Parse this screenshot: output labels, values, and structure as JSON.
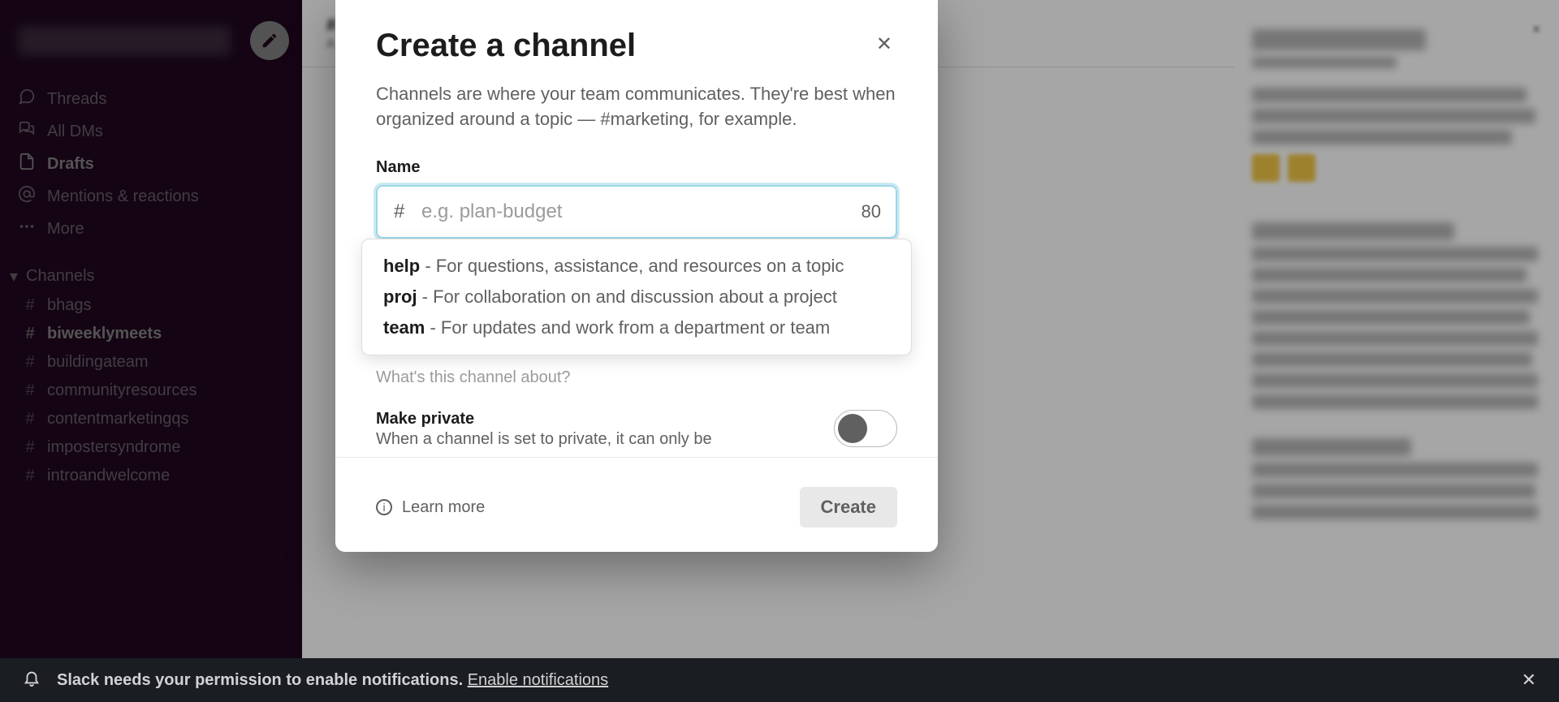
{
  "sidebar": {
    "nav": [
      {
        "label": "Threads",
        "icon": "threads-icon"
      },
      {
        "label": "All DMs",
        "icon": "dms-icon"
      },
      {
        "label": "Drafts",
        "icon": "drafts-icon",
        "bold": true
      },
      {
        "label": "Mentions & reactions",
        "icon": "mentions-icon"
      },
      {
        "label": "More",
        "icon": "more-icon"
      }
    ],
    "channels_header": "Channels",
    "channels": [
      {
        "name": "bhags"
      },
      {
        "name": "biweeklymeets",
        "bold": true
      },
      {
        "name": "buildingateam"
      },
      {
        "name": "communityresources"
      },
      {
        "name": "contentmarketingqs"
      },
      {
        "name": "impostersyndrome"
      },
      {
        "name": "introandwelcome"
      }
    ]
  },
  "main_header": {
    "line1_prefix": "#",
    "line2_prefix": "A"
  },
  "modal": {
    "title": "Create a channel",
    "description": "Channels are where your team communicates. They're best when organized around a topic — #marketing, for example.",
    "name_label": "Name",
    "name_placeholder": "e.g. plan-budget",
    "name_prefix": "#",
    "char_count": "80",
    "suggestions": [
      {
        "prefix": "help",
        "desc": " - For questions, assistance, and resources on a topic"
      },
      {
        "prefix": "proj",
        "desc": " - For collaboration on and discussion about a project"
      },
      {
        "prefix": "team",
        "desc": " - For updates and work from a department or team"
      }
    ],
    "description_hint": "What's this channel about?",
    "private_title": "Make private",
    "private_sub": "When a channel is set to private, it can only be",
    "learn_more": "Learn more",
    "create_label": "Create"
  },
  "notification": {
    "text": "Slack needs your permission to enable notifications. ",
    "link": "Enable notifications"
  }
}
